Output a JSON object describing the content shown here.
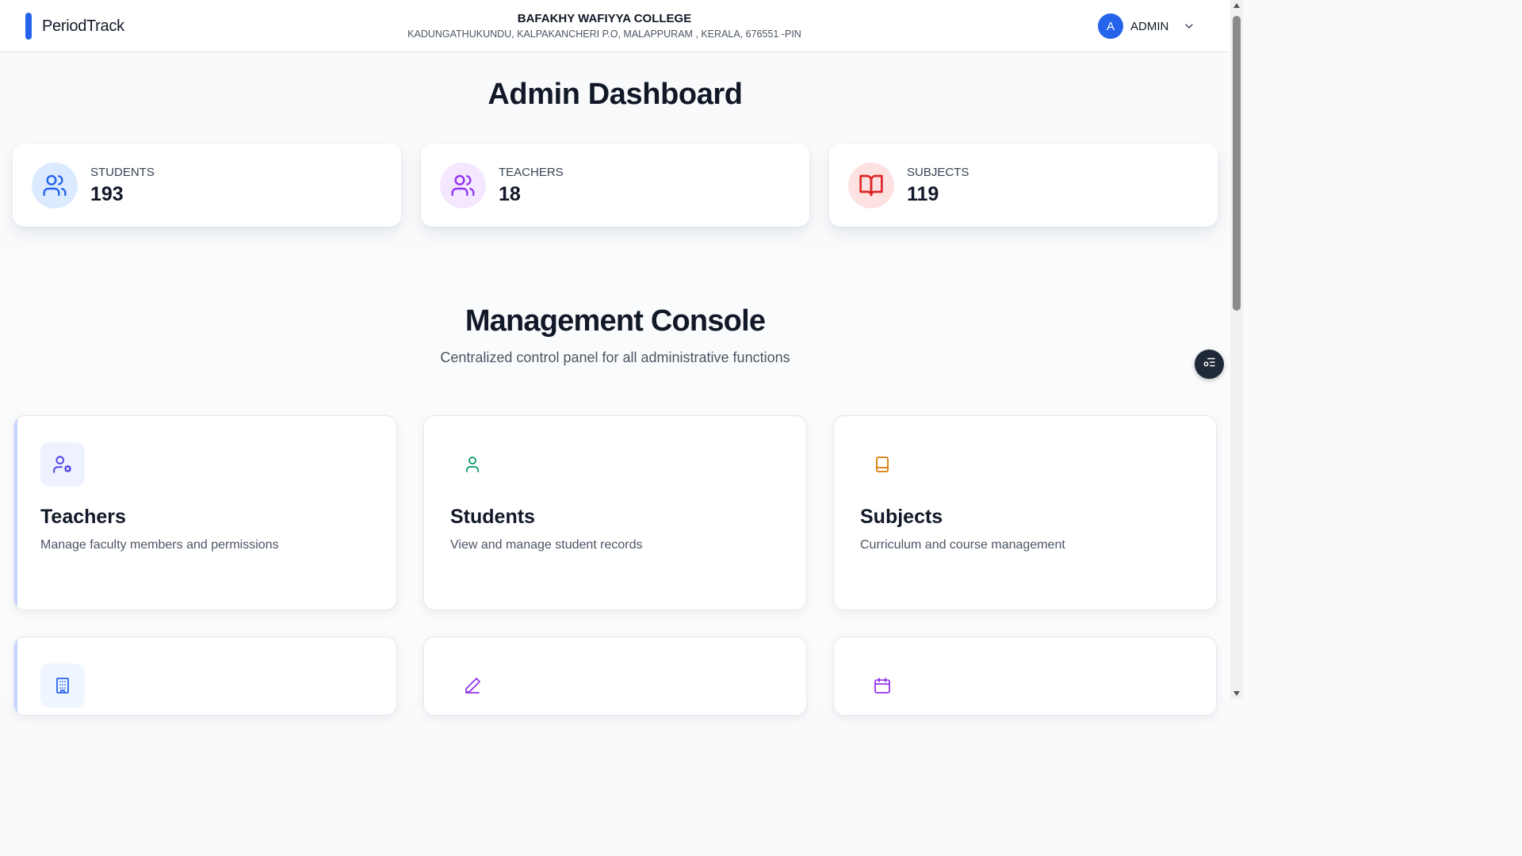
{
  "header": {
    "brand": "PeriodTrack",
    "college_name": "BAFAKHY WAFIYYA COLLEGE",
    "college_address": "KADUNGATHUKUNDU, KALPAKANCHERI P.O, MALAPPURAM , KERALA, 676551 -PIN",
    "user_initial": "A",
    "user_name": "ADMIN",
    "accent_color": "#2563eb"
  },
  "page": {
    "title": "Admin Dashboard"
  },
  "stats": [
    {
      "label": "STUDENTS",
      "value": "193",
      "icon": "users-icon",
      "color": "#2563eb",
      "bg": "#dbeafe"
    },
    {
      "label": "TEACHERS",
      "value": "18",
      "icon": "users-icon",
      "color": "#9333ea",
      "bg": "#f3e8ff"
    },
    {
      "label": "SUBJECTS",
      "value": "119",
      "icon": "book-open-icon",
      "color": "#dc2626",
      "bg": "#fee2e2"
    }
  ],
  "management": {
    "title": "Management Console",
    "subtitle": "Centralized control panel for all administrative functions",
    "cards": [
      {
        "title": "Teachers",
        "description": "Manage faculty members and permissions",
        "icon": "user-cog-icon",
        "color": "#4f46e5"
      },
      {
        "title": "Students",
        "description": "View and manage student records",
        "icon": "user-icon",
        "color": "#059669"
      },
      {
        "title": "Subjects",
        "description": "Curriculum and course management",
        "icon": "book-icon",
        "color": "#d97706"
      },
      {
        "title": "",
        "description": "",
        "icon": "building-icon",
        "color": "#2563eb"
      },
      {
        "title": "",
        "description": "",
        "icon": "pencil-icon",
        "color": "#9333ea"
      },
      {
        "title": "",
        "description": "",
        "icon": "calendar-icon",
        "color": "#9333ea"
      }
    ]
  }
}
